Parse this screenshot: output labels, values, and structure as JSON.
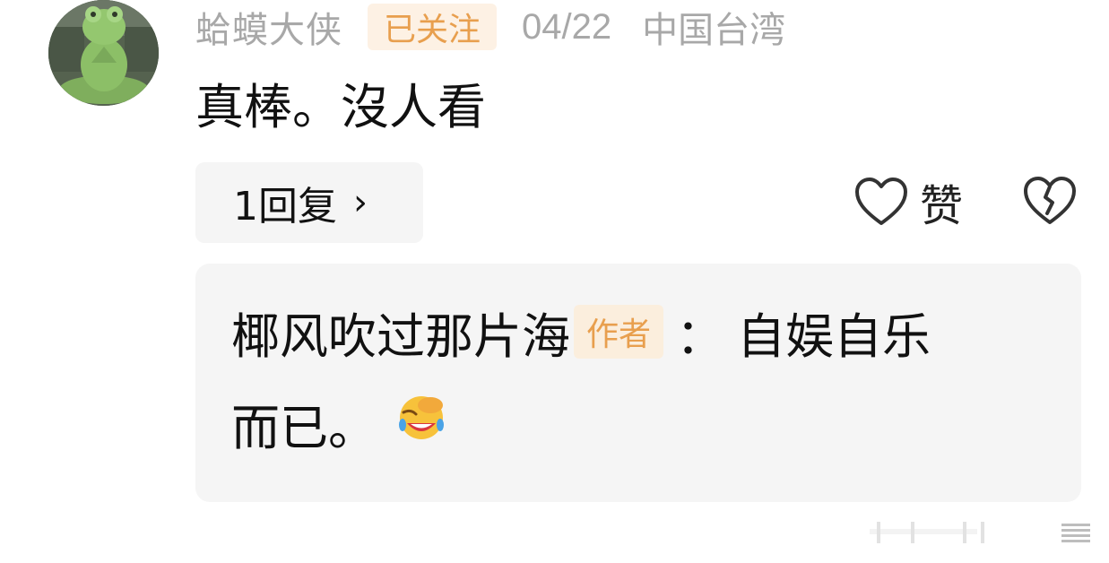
{
  "comment": {
    "username": "蛤蟆大侠",
    "follow_status": "已关注",
    "date": "04/22",
    "location": "中国台湾",
    "text": "真棒。沒人看",
    "avatar_icon": "frog-statue-avatar"
  },
  "actions": {
    "reply_count_label": "1回复",
    "reply_chevron": "›",
    "like_label": "赞",
    "like_icon": "heart-outline-icon",
    "dislike_icon": "broken-heart-icon"
  },
  "reply": {
    "author_name": "椰风吹过那片海",
    "author_badge": "作者",
    "separator": "：",
    "text_line1": "自娱自乐",
    "text_line2": "而已。",
    "emoji": "facepalm-laugh-emoji"
  },
  "colors": {
    "meta_gray": "#a8a8a8",
    "badge_orange": "#e89f4e",
    "badge_bg": "#fdf1e4",
    "panel_bg": "#f5f5f5"
  }
}
